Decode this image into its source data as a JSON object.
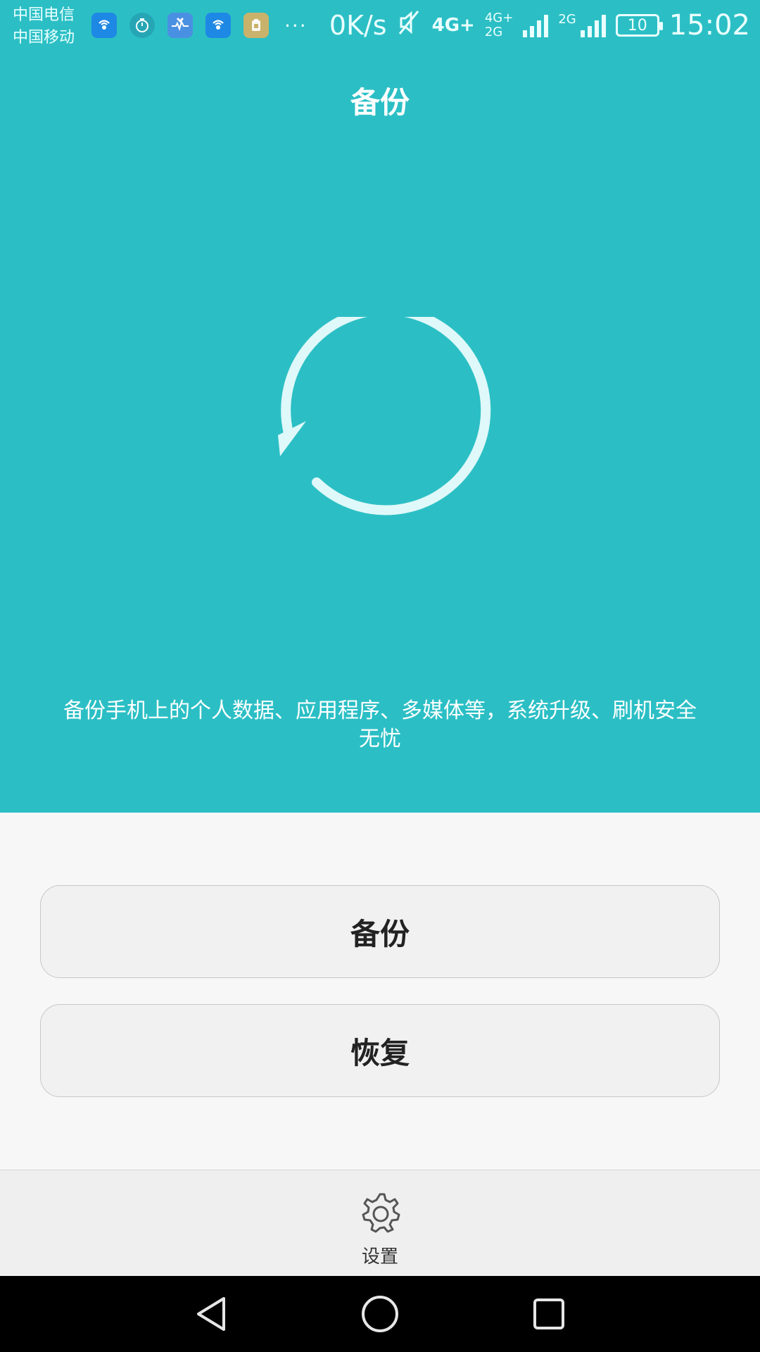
{
  "status_bar": {
    "carrier_1": "中国电信",
    "carrier_2": "中国移动",
    "more": "···",
    "speed": "0K/s",
    "network_primary": "4G+",
    "network_secondary": "4G+",
    "network_tertiary": "2G",
    "network_quaternary": "2G",
    "battery_level": "10",
    "time": "15:02",
    "icons": [
      "wifi-hotspot-icon",
      "timer-icon",
      "heart-monitor-icon",
      "wifi-hotspot-icon",
      "clipboard-icon",
      "mute-icon",
      "signal-bars-icon",
      "battery-icon"
    ]
  },
  "header": {
    "title": "备份"
  },
  "hero": {
    "description": "备份手机上的个人数据、应用程序、多媒体等，系统升级、刷机安全无忧"
  },
  "actions": {
    "backup_label": "备份",
    "restore_label": "恢复"
  },
  "bottom": {
    "settings_label": "设置"
  },
  "colors": {
    "hero_bg": "#2bbfc5",
    "accent_light": "#dff8f9",
    "button_bg": "#f1f1f1",
    "page_bg": "#f7f7f7"
  }
}
